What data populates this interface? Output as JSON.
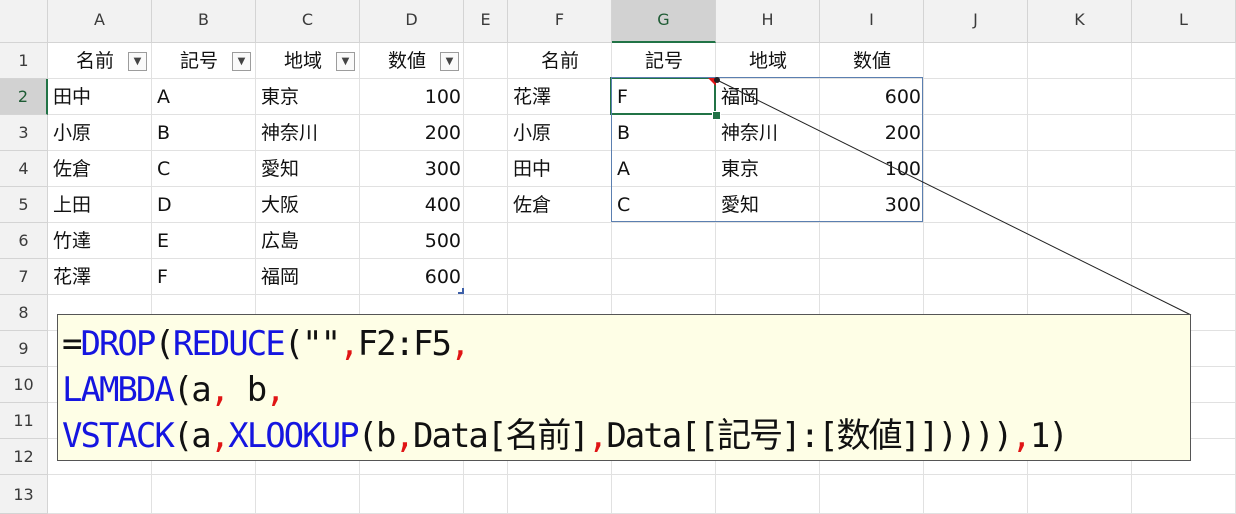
{
  "columns": [
    "A",
    "B",
    "C",
    "D",
    "E",
    "F",
    "G",
    "H",
    "I",
    "J",
    "K",
    "L"
  ],
  "rows": [
    "1",
    "2",
    "3",
    "4",
    "5",
    "6",
    "7",
    "8",
    "9",
    "10",
    "11",
    "12",
    "13"
  ],
  "table1": {
    "headers": [
      "名前",
      "記号",
      "地域",
      "数値"
    ],
    "filter_icon": "dropdown-arrow-icon",
    "rows": [
      [
        "田中",
        "A",
        "東京",
        "100"
      ],
      [
        "小原",
        "B",
        "神奈川",
        "200"
      ],
      [
        "佐倉",
        "C",
        "愛知",
        "300"
      ],
      [
        "上田",
        "D",
        "大阪",
        "400"
      ],
      [
        "竹達",
        "E",
        "広島",
        "500"
      ],
      [
        "花澤",
        "F",
        "福岡",
        "600"
      ]
    ]
  },
  "lookup": {
    "names_header": "名前",
    "names": [
      "花澤",
      "小原",
      "田中",
      "佐倉"
    ],
    "headers": [
      "記号",
      "地域",
      "数値"
    ],
    "rows": [
      [
        "F",
        "福岡",
        "600"
      ],
      [
        "B",
        "神奈川",
        "200"
      ],
      [
        "A",
        "東京",
        "100"
      ],
      [
        "C",
        "愛知",
        "300"
      ]
    ]
  },
  "formula_note": {
    "line1": {
      "a": "=",
      "b": "DROP",
      "c": "(",
      "d": "REDUCE",
      "e": "(\"\"",
      "f": ",",
      "g": "F2:F5",
      "h": ","
    },
    "line2": {
      "a": "LAMBDA",
      "b": "(a",
      "c": ",",
      "d": " b",
      "e": ","
    },
    "line3": {
      "a": "VSTACK",
      "b": "(a",
      "c": ",",
      "d": "XLOOKUP",
      "e": "(b",
      "f": ",",
      "g": "Data[名前]",
      "h": ",",
      "i": "Data[[記号]:[数値]]))))",
      "j": ",",
      "k": "1)"
    }
  },
  "colors": {
    "function": "#1515e0",
    "separator": "#e01515",
    "selection": "#217346",
    "table_border": "#5b7fb0"
  }
}
